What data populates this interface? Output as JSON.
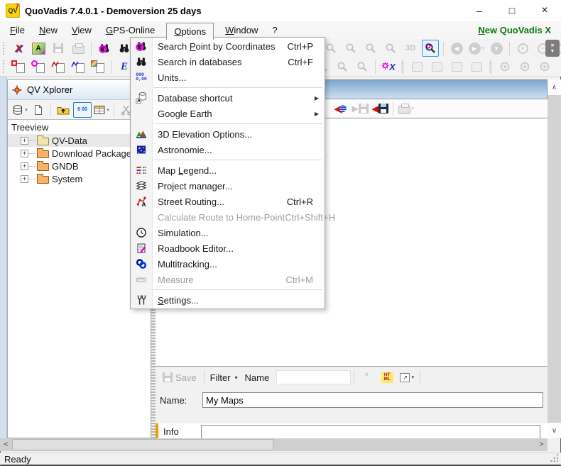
{
  "window": {
    "title": "QuoVadis 7.4.0.1 - Demoversion 25 days",
    "app_icon_text": "QV",
    "app_icon_sup": "7",
    "minimize_glyph": "–",
    "maximize_glyph": "□",
    "close_glyph": "×"
  },
  "menubar": {
    "items": [
      {
        "key": "F",
        "post": "ile"
      },
      {
        "key": "N",
        "post": "ew"
      },
      {
        "key": "V",
        "post": "iew"
      },
      {
        "key": "G",
        "post": "PS-Online"
      },
      {
        "key": "O",
        "post": "ptions",
        "open": true
      },
      {
        "key": "W",
        "post": "indow"
      },
      {
        "key": "",
        "post": "?"
      }
    ],
    "right_link": {
      "key": "N",
      "post": "ew QuoVadis X"
    }
  },
  "options_menu": {
    "items": [
      {
        "icon": "search-point-icon",
        "pre": "Search ",
        "key": "P",
        "post": "oint by Coordinates",
        "shortcut": "Ctrl+P"
      },
      {
        "icon": "search-databases-icon",
        "pre": "Search in databases",
        "shortcut": "Ctrl+F"
      },
      {
        "icon": "units-icon",
        "pre": "Units...",
        "separator_after": true
      },
      {
        "icon": "database-shortcut-icon",
        "pre": "Database shortcut",
        "submenu": true
      },
      {
        "icon": "",
        "pre": "Google Earth",
        "submenu": true,
        "separator_after": true
      },
      {
        "icon": "elevation-icon",
        "pre": "3D Elevation Options..."
      },
      {
        "icon": "astronomy-icon",
        "pre": "Astronomie...",
        "separator_after": true
      },
      {
        "icon": "map-legend-icon",
        "pre": "Map ",
        "key": "L",
        "post": "egend..."
      },
      {
        "icon": "project-manager-icon",
        "pre": "Project manager..."
      },
      {
        "icon": "street-routing-icon",
        "pre": "Street Routing...",
        "shortcut": "Ctrl+R"
      },
      {
        "icon": "",
        "pre": "Calculate Route to Home-Point",
        "shortcut": "Ctrl+Shift+H",
        "disabled": true
      },
      {
        "icon": "simulation-icon",
        "pre": "Simulation..."
      },
      {
        "icon": "roadbook-icon",
        "pre": "Roadbook Editor..."
      },
      {
        "icon": "multitracking-icon",
        "pre": "Multitracking..."
      },
      {
        "icon": "measure-icon",
        "pre": "Measure",
        "shortcut": "Ctrl+M",
        "disabled": true,
        "separator_after": true
      },
      {
        "icon": "settings-icon",
        "pre": "",
        "key": "S",
        "post": "ettings..."
      }
    ]
  },
  "xplorer": {
    "title": "QV Xplorer",
    "treeview_label": "Treeview",
    "layout_button_text": "0 00",
    "tree": [
      {
        "label": "QV-Data",
        "selected": true,
        "folder": "yellow"
      },
      {
        "label": "Download Packages",
        "folder": "orange"
      },
      {
        "label": "GNDB",
        "folder": "orange"
      },
      {
        "label": "System",
        "folder": "orange"
      }
    ]
  },
  "bottom_panel": {
    "save_label": "Save",
    "filter_label": "Filter",
    "name_toolbar_label": "Name",
    "filter_input_value": "",
    "name_label": "Name:",
    "name_value": "My Maps",
    "info_label": "Info"
  },
  "statusbar": {
    "text": "Ready"
  },
  "glyphs": {
    "dropdown": "▾",
    "submenu_arrow": "▶",
    "left_tri": "◀",
    "right_tri": "▶",
    "down_tri": "▼",
    "scroll_up": "∧",
    "scroll_down": "∨",
    "scroll_left": "<",
    "scroll_right": ">",
    "overflow_chevrons": "»",
    "plus": "+",
    "minus": "−",
    "exit_letter": "X",
    "map_letter": "A",
    "e_letter": "E",
    "three_d": "3D",
    "units_top": "000",
    "units_bottom": "0,00",
    "html_top": "HT",
    "html_bottom": "ML",
    "sort_top": "A",
    "sort_bottom": "→",
    "up_arrow": "↑",
    "open_arrow": "↗"
  },
  "colors": {
    "accent_selection": "#3e9ae4",
    "link_green": "#0a7a0a",
    "map_titlebar_blue": "#7fa7cd",
    "magenta_marker": "#ee00ee",
    "orange_info_bar": "#f59b00"
  }
}
